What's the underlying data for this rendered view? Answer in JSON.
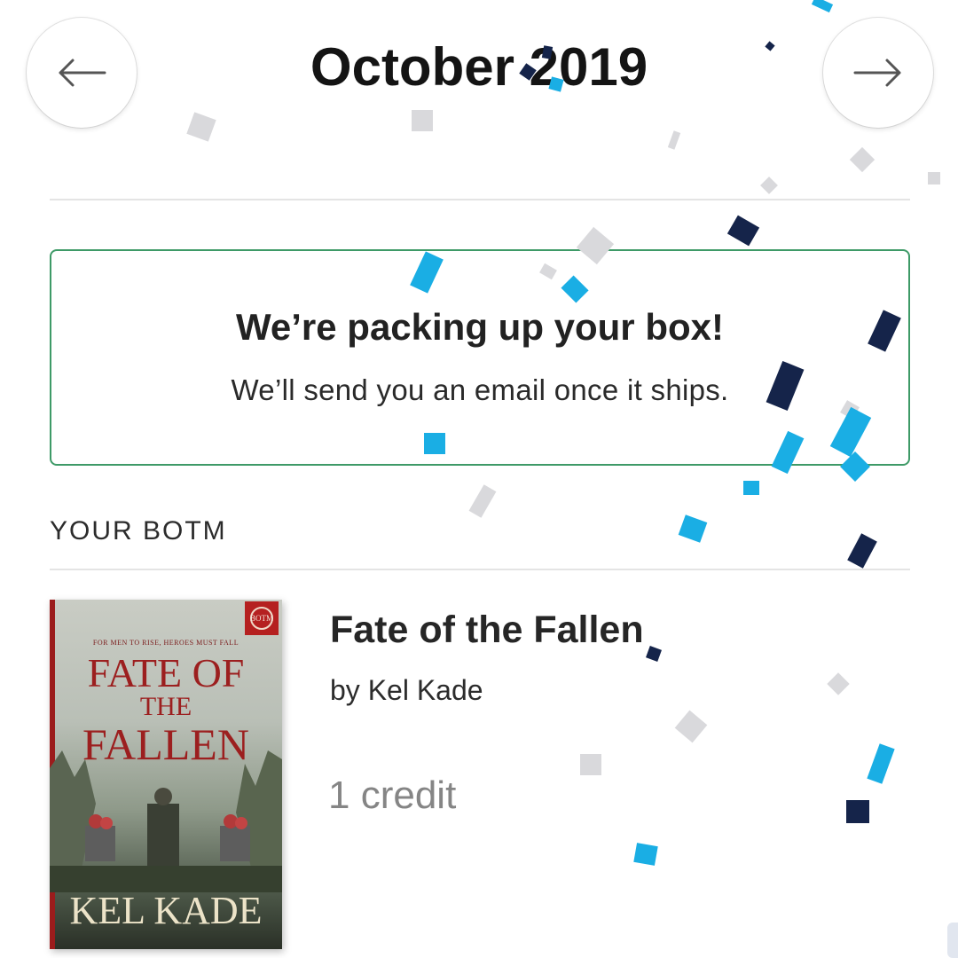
{
  "header": {
    "month_title": "October 2019",
    "prev_icon": "arrow-left-icon",
    "next_icon": "arrow-right-icon"
  },
  "status": {
    "heading": "We’re packing up your box!",
    "subtext": "We’ll send you an email once it ships.",
    "border_color": "#3e9a67"
  },
  "section": {
    "label": "YOUR BOTM"
  },
  "book": {
    "title": "Fate of the Fallen",
    "author": "by Kel Kade",
    "credit": "1 credit",
    "cover": {
      "tagline": "FOR MEN TO RISE, HEROES MUST FALL",
      "title_line1": "FATE OF",
      "title_line2": "THE",
      "title_line3": "FALLEN",
      "author": "KEL KADE",
      "badge_icon": "botm-badge-icon"
    }
  },
  "colors": {
    "confetti_grey": "#d9d9dc",
    "confetti_blue": "#1aaee4",
    "confetti_navy": "#15244a"
  }
}
